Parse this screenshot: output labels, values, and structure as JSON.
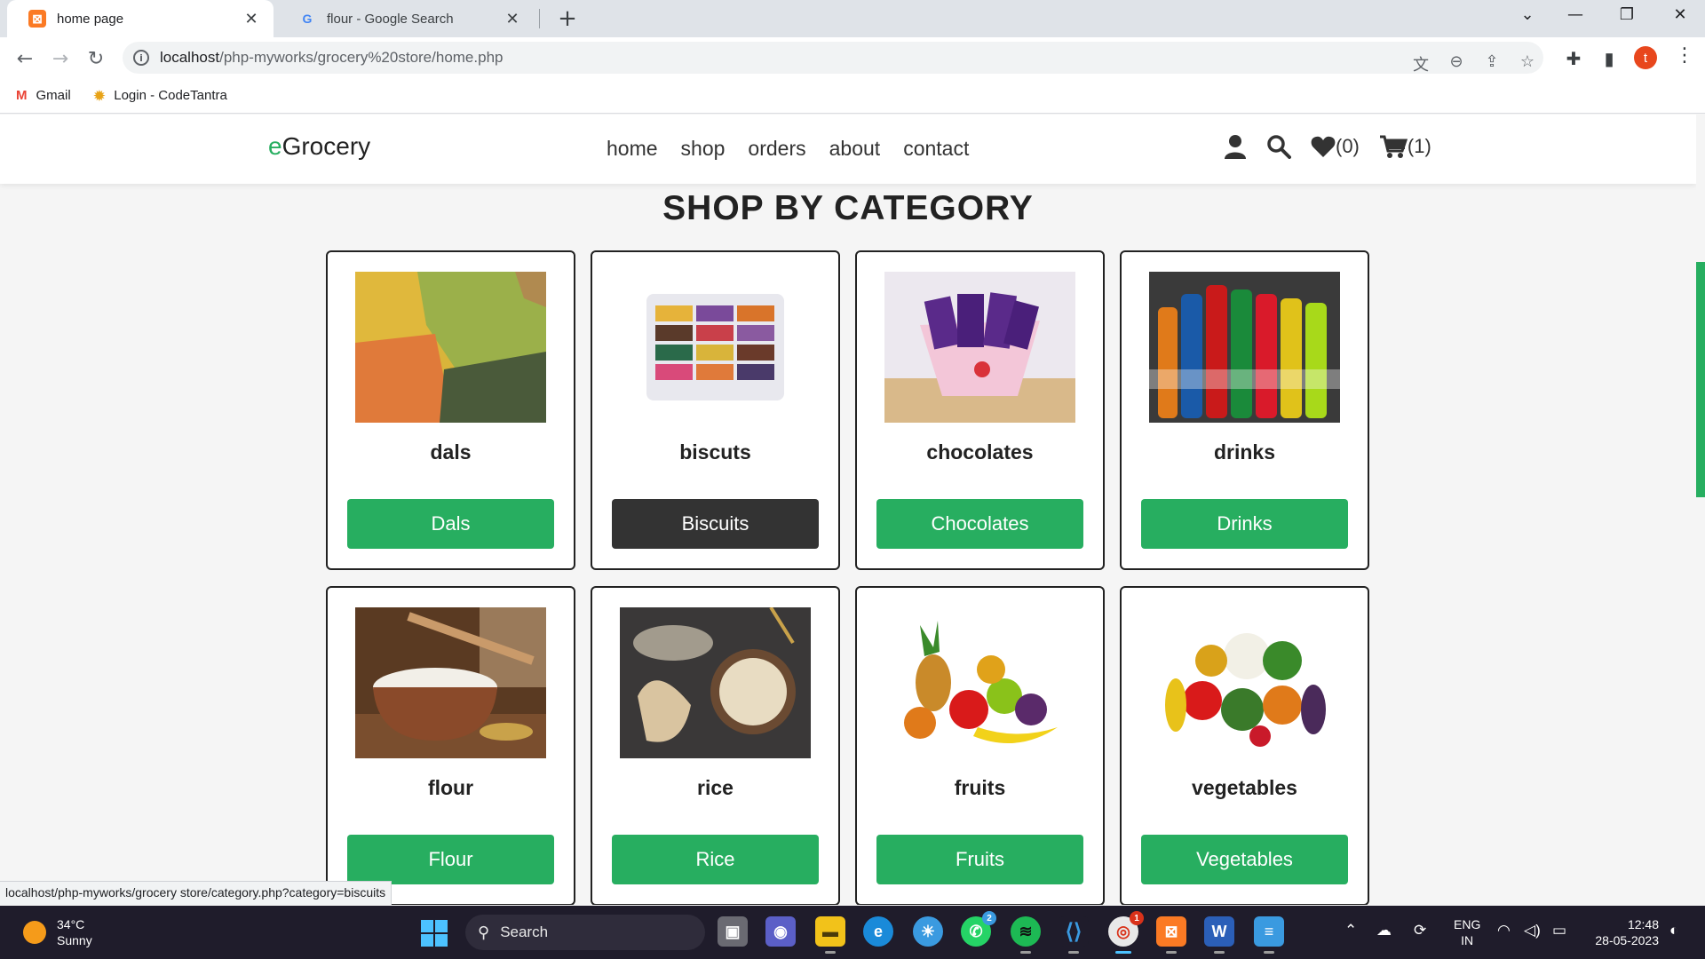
{
  "browser": {
    "tabs": [
      {
        "title": "home page",
        "active": true
      },
      {
        "title": "flour - Google Search",
        "active": false
      }
    ],
    "url_host": "localhost",
    "url_path": "/php-myworks/grocery%20store/home.php",
    "bookmarks": [
      {
        "label": "Gmail",
        "icon": "gmail-icon"
      },
      {
        "label": "Login - CodeTantra",
        "icon": "codetantra-icon"
      }
    ],
    "profile_initial": "t"
  },
  "site": {
    "logo_e": "e",
    "logo_rest": "Grocery",
    "nav": [
      "home",
      "shop",
      "orders",
      "about",
      "contact"
    ],
    "wishlist_count": "(0)",
    "cart_count": "(1)"
  },
  "section_title": "SHOP BY CATEGORY",
  "categories": [
    {
      "name": "dals",
      "button": "Dals"
    },
    {
      "name": "biscuts",
      "button": "Biscuits",
      "hovered": true
    },
    {
      "name": "chocolates",
      "button": "Chocolates"
    },
    {
      "name": "drinks",
      "button": "Drinks"
    },
    {
      "name": "flour",
      "button": "Flour"
    },
    {
      "name": "rice",
      "button": "Rice"
    },
    {
      "name": "fruits",
      "button": "Fruits"
    },
    {
      "name": "vegetables",
      "button": "Vegetables"
    }
  ],
  "status_url": "localhost/php-myworks/grocery store/category.php?category=biscuits",
  "taskbar": {
    "temperature": "34°C",
    "weather": "Sunny",
    "search_label": "Search",
    "lang_top": "ENG",
    "lang_bottom": "IN",
    "time": "12:48",
    "date": "28-05-2023",
    "whatsapp_badge": "2",
    "chrome_badge": "1"
  },
  "colors": {
    "accent_green": "#27ae60",
    "button_hover": "#333333"
  }
}
